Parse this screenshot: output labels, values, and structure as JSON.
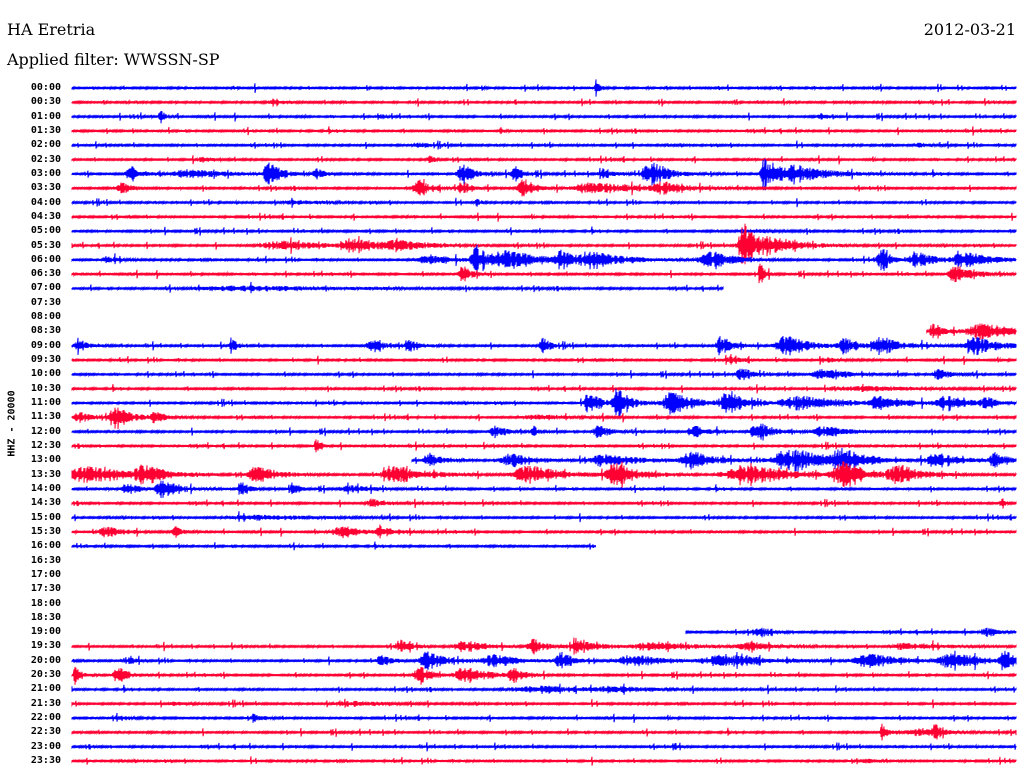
{
  "header": {
    "station": "HA Eretria",
    "date": "2012-03-21",
    "filter": "Applied filter: WWSSN-SP"
  },
  "channel_label": "HHZ - 20000",
  "colors": {
    "even": "#0000ff",
    "odd": "#ff0033"
  },
  "rows": [
    {
      "time": "00:00",
      "start": 0,
      "end": 1,
      "bursts": [
        [
          0.556,
          8,
          0.003
        ]
      ]
    },
    {
      "time": "00:30",
      "start": 0,
      "end": 1,
      "bursts": [
        [
          0.216,
          3,
          0.008
        ]
      ]
    },
    {
      "time": "01:00",
      "start": 0,
      "end": 1,
      "bursts": [
        [
          0.095,
          5,
          0.005
        ],
        [
          0.326,
          3,
          0.004
        ],
        [
          0.794,
          3,
          0.005
        ]
      ]
    },
    {
      "time": "01:30",
      "start": 0,
      "end": 1,
      "bursts": [
        [
          0.455,
          3,
          0.003
        ]
      ]
    },
    {
      "time": "02:00",
      "start": 0,
      "end": 1,
      "bursts": [
        [
          0.37,
          2,
          0.01
        ],
        [
          0.9,
          2,
          0.01
        ]
      ]
    },
    {
      "time": "02:30",
      "start": 0,
      "end": 1,
      "bursts": [
        [
          0.379,
          4,
          0.004
        ],
        [
          0.14,
          2,
          0.01
        ]
      ]
    },
    {
      "time": "03:00",
      "start": 0,
      "end": 1,
      "bursts": [
        [
          0.065,
          7,
          0.01
        ],
        [
          0.13,
          4,
          0.03
        ],
        [
          0.21,
          12,
          0.01
        ],
        [
          0.26,
          6,
          0.006
        ],
        [
          0.415,
          10,
          0.01
        ],
        [
          0.47,
          7,
          0.008
        ],
        [
          0.565,
          5,
          0.01
        ],
        [
          0.615,
          12,
          0.015
        ],
        [
          0.735,
          16,
          0.008
        ],
        [
          0.77,
          8,
          0.03
        ]
      ]
    },
    {
      "time": "03:30",
      "start": 0,
      "end": 1,
      "bursts": [
        [
          0.055,
          5,
          0.01
        ],
        [
          0.37,
          8,
          0.01
        ],
        [
          0.415,
          6,
          0.008
        ],
        [
          0.48,
          9,
          0.01
        ],
        [
          0.56,
          5,
          0.04
        ],
        [
          0.63,
          5,
          0.02
        ]
      ]
    },
    {
      "time": "04:00",
      "start": 0,
      "end": 1,
      "bursts": [
        [
          0.43,
          4,
          0.003
        ],
        [
          0.24,
          2,
          0.02
        ]
      ]
    },
    {
      "time": "04:30",
      "start": 0,
      "end": 1,
      "bursts": []
    },
    {
      "time": "05:00",
      "start": 0,
      "end": 1,
      "bursts": [
        [
          0.72,
          2,
          0.02
        ]
      ]
    },
    {
      "time": "05:30",
      "start": 0,
      "end": 1,
      "bursts": [
        [
          0.23,
          4,
          0.04
        ],
        [
          0.3,
          6,
          0.02
        ],
        [
          0.35,
          4,
          0.03
        ],
        [
          0.715,
          22,
          0.012
        ],
        [
          0.75,
          6,
          0.025
        ]
      ]
    },
    {
      "time": "06:00",
      "start": 0,
      "end": 1,
      "bursts": [
        [
          0.04,
          3,
          0.01
        ],
        [
          0.38,
          5,
          0.02
        ],
        [
          0.43,
          14,
          0.01
        ],
        [
          0.47,
          8,
          0.03
        ],
        [
          0.52,
          10,
          0.01
        ],
        [
          0.56,
          6,
          0.03
        ],
        [
          0.68,
          8,
          0.02
        ],
        [
          0.86,
          10,
          0.01
        ],
        [
          0.9,
          6,
          0.02
        ],
        [
          0.95,
          8,
          0.02
        ]
      ]
    },
    {
      "time": "06:30",
      "start": 0,
      "end": 1,
      "bursts": [
        [
          0.415,
          8,
          0.008
        ],
        [
          0.73,
          12,
          0.004
        ],
        [
          0.94,
          8,
          0.015
        ]
      ]
    },
    {
      "time": "07:00",
      "start": 0,
      "end": 0.69,
      "bursts": [
        [
          0.2,
          2,
          0.1
        ]
      ]
    },
    {
      "time": "07:30",
      "start": 0,
      "end": 0,
      "bursts": []
    },
    {
      "time": "08:00",
      "start": 0,
      "end": 0,
      "bursts": []
    },
    {
      "time": "08:30",
      "start": 0.905,
      "end": 1,
      "bursts": [
        [
          0.915,
          7,
          0.01
        ],
        [
          0.97,
          7,
          0.03
        ]
      ]
    },
    {
      "time": "09:00",
      "start": 0,
      "end": 1,
      "bursts": [
        [
          0.01,
          5,
          0.01
        ],
        [
          0.17,
          8,
          0.004
        ],
        [
          0.32,
          6,
          0.01
        ],
        [
          0.36,
          5,
          0.01
        ],
        [
          0.5,
          8,
          0.006
        ],
        [
          0.69,
          9,
          0.01
        ],
        [
          0.76,
          9,
          0.02
        ],
        [
          0.82,
          7,
          0.01
        ],
        [
          0.86,
          8,
          0.02
        ],
        [
          0.96,
          8,
          0.02
        ]
      ]
    },
    {
      "time": "09:30",
      "start": 0,
      "end": 1,
      "bursts": [
        [
          0.7,
          3,
          0.01
        ],
        [
          0.8,
          3,
          0.01
        ]
      ]
    },
    {
      "time": "10:00",
      "start": 0,
      "end": 1,
      "bursts": [
        [
          0.71,
          7,
          0.01
        ],
        [
          0.8,
          5,
          0.02
        ],
        [
          0.92,
          5,
          0.01
        ]
      ]
    },
    {
      "time": "10:30",
      "start": 0,
      "end": 1,
      "bursts": [
        [
          0.85,
          2,
          0.05
        ]
      ]
    },
    {
      "time": "11:00",
      "start": 0,
      "end": 1,
      "bursts": [
        [
          0.55,
          10,
          0.01
        ],
        [
          0.58,
          14,
          0.01
        ],
        [
          0.64,
          10,
          0.02
        ],
        [
          0.7,
          8,
          0.02
        ],
        [
          0.78,
          6,
          0.04
        ],
        [
          0.86,
          6,
          0.02
        ],
        [
          0.93,
          6,
          0.02
        ],
        [
          0.97,
          5,
          0.01
        ]
      ]
    },
    {
      "time": "11:30",
      "start": 0,
      "end": 1,
      "bursts": [
        [
          0.01,
          6,
          0.01
        ],
        [
          0.05,
          9,
          0.015
        ],
        [
          0.09,
          4,
          0.01
        ],
        [
          0.5,
          2,
          0.03
        ]
      ]
    },
    {
      "time": "12:00",
      "start": 0,
      "end": 1,
      "bursts": [
        [
          0.45,
          5,
          0.01
        ],
        [
          0.49,
          5,
          0.005
        ],
        [
          0.56,
          6,
          0.01
        ],
        [
          0.66,
          6,
          0.01
        ],
        [
          0.73,
          8,
          0.015
        ],
        [
          0.8,
          5,
          0.02
        ]
      ]
    },
    {
      "time": "12:30",
      "start": 0,
      "end": 1,
      "bursts": [
        [
          0.26,
          8,
          0.004
        ]
      ]
    },
    {
      "time": "13:00",
      "start": 0.36,
      "end": 1,
      "bursts": [
        [
          0.38,
          7,
          0.01
        ],
        [
          0.47,
          6,
          0.02
        ],
        [
          0.57,
          5,
          0.03
        ],
        [
          0.66,
          8,
          0.02
        ],
        [
          0.77,
          10,
          0.04
        ],
        [
          0.82,
          8,
          0.02
        ],
        [
          0.92,
          6,
          0.02
        ],
        [
          0.98,
          8,
          0.01
        ]
      ]
    },
    {
      "time": "13:30",
      "start": 0,
      "end": 1,
      "bursts": [
        [
          0.02,
          9,
          0.03
        ],
        [
          0.08,
          8,
          0.02
        ],
        [
          0.2,
          7,
          0.02
        ],
        [
          0.35,
          7,
          0.03
        ],
        [
          0.49,
          8,
          0.03
        ],
        [
          0.58,
          10,
          0.02
        ],
        [
          0.72,
          9,
          0.04
        ],
        [
          0.82,
          12,
          0.02
        ],
        [
          0.88,
          8,
          0.02
        ]
      ]
    },
    {
      "time": "14:00",
      "start": 0,
      "end": 1,
      "bursts": [
        [
          0.06,
          5,
          0.01
        ],
        [
          0.1,
          8,
          0.015
        ],
        [
          0.18,
          9,
          0.006
        ],
        [
          0.235,
          7,
          0.005
        ],
        [
          0.3,
          3,
          0.02
        ]
      ]
    },
    {
      "time": "14:30",
      "start": 0,
      "end": 1,
      "bursts": [
        [
          0.32,
          4,
          0.01
        ],
        [
          0.985,
          4,
          0.003
        ]
      ]
    },
    {
      "time": "15:00",
      "start": 0,
      "end": 1,
      "bursts": [
        [
          0.2,
          2,
          0.05
        ]
      ]
    },
    {
      "time": "15:30",
      "start": 0,
      "end": 1,
      "bursts": [
        [
          0.04,
          5,
          0.015
        ],
        [
          0.11,
          5,
          0.006
        ],
        [
          0.29,
          5,
          0.02
        ],
        [
          0.33,
          6,
          0.01
        ]
      ]
    },
    {
      "time": "16:00",
      "start": 0,
      "end": 0.555,
      "bursts": []
    },
    {
      "time": "16:30",
      "start": 0,
      "end": 0,
      "bursts": []
    },
    {
      "time": "17:00",
      "start": 0,
      "end": 0,
      "bursts": []
    },
    {
      "time": "17:30",
      "start": 0,
      "end": 0,
      "bursts": []
    },
    {
      "time": "18:00",
      "start": 0,
      "end": 0,
      "bursts": []
    },
    {
      "time": "18:30",
      "start": 0,
      "end": 0,
      "bursts": []
    },
    {
      "time": "19:00",
      "start": 0.65,
      "end": 1,
      "bursts": [
        [
          0.73,
          4,
          0.01
        ],
        [
          0.97,
          4,
          0.01
        ]
      ]
    },
    {
      "time": "19:30",
      "start": 0,
      "end": 1,
      "bursts": [
        [
          0.35,
          6,
          0.01
        ],
        [
          0.42,
          5,
          0.02
        ],
        [
          0.49,
          7,
          0.01
        ],
        [
          0.54,
          5,
          0.02
        ],
        [
          0.62,
          4,
          0.03
        ],
        [
          0.72,
          4,
          0.02
        ],
        [
          0.89,
          3,
          0.03
        ]
      ]
    },
    {
      "time": "20:00",
      "start": 0,
      "end": 1,
      "bursts": [
        [
          0.06,
          3,
          0.01
        ],
        [
          0.33,
          5,
          0.01
        ],
        [
          0.38,
          10,
          0.015
        ],
        [
          0.45,
          6,
          0.02
        ],
        [
          0.52,
          8,
          0.01
        ],
        [
          0.6,
          5,
          0.03
        ],
        [
          0.7,
          5,
          0.04
        ],
        [
          0.85,
          6,
          0.03
        ],
        [
          0.94,
          6,
          0.03
        ],
        [
          0.99,
          8,
          0.01
        ]
      ]
    },
    {
      "time": "20:30",
      "start": 0,
      "end": 1,
      "bursts": [
        [
          0.005,
          8,
          0.005
        ],
        [
          0.05,
          10,
          0.008
        ],
        [
          0.37,
          8,
          0.01
        ],
        [
          0.42,
          7,
          0.02
        ],
        [
          0.47,
          6,
          0.01
        ]
      ]
    },
    {
      "time": "21:00",
      "start": 0,
      "end": 1,
      "bursts": [
        [
          0.5,
          3,
          0.05
        ],
        [
          0.58,
          2,
          0.03
        ]
      ]
    },
    {
      "time": "21:30",
      "start": 0,
      "end": 1,
      "bursts": [
        [
          0.11,
          2,
          0.01
        ],
        [
          0.3,
          2,
          0.03
        ]
      ]
    },
    {
      "time": "22:00",
      "start": 0,
      "end": 1,
      "bursts": [
        [
          0.05,
          2,
          0.01
        ],
        [
          0.195,
          4,
          0.006
        ]
      ]
    },
    {
      "time": "22:30",
      "start": 0,
      "end": 1,
      "bursts": [
        [
          0.86,
          10,
          0.005
        ],
        [
          0.9,
          4,
          0.02
        ],
        [
          0.915,
          7,
          0.005
        ]
      ]
    },
    {
      "time": "23:00",
      "start": 0,
      "end": 1,
      "bursts": [
        [
          0.64,
          3,
          0.004
        ]
      ]
    },
    {
      "time": "23:30",
      "start": 0,
      "end": 1,
      "bursts": [
        [
          0.84,
          2,
          0.01
        ]
      ]
    }
  ]
}
